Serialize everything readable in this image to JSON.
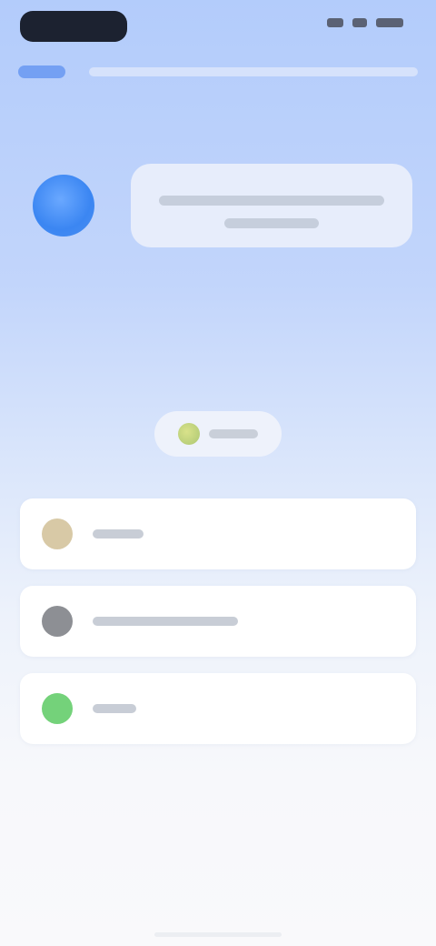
{
  "status_bar": {
    "time": "",
    "icons": [
      "signal-icon",
      "wifi-icon",
      "battery-icon"
    ]
  },
  "nav": {
    "back_label": "",
    "title": ""
  },
  "assistant": {
    "avatar_icon": "assistant-avatar-icon",
    "message": ""
  },
  "center_chip": {
    "icon": "lightbulb-icon",
    "label": ""
  },
  "options": [
    {
      "icon": "document-icon",
      "label": "",
      "color": "#d8c9a6"
    },
    {
      "icon": "settings-icon",
      "label": "",
      "color": "#8d8f94"
    },
    {
      "icon": "check-icon",
      "label": "",
      "color": "#74d27a"
    }
  ],
  "colors": {
    "accent": "#3c7df0",
    "background_top": "#b3ccfb",
    "background_bottom": "#f9f9fb"
  }
}
